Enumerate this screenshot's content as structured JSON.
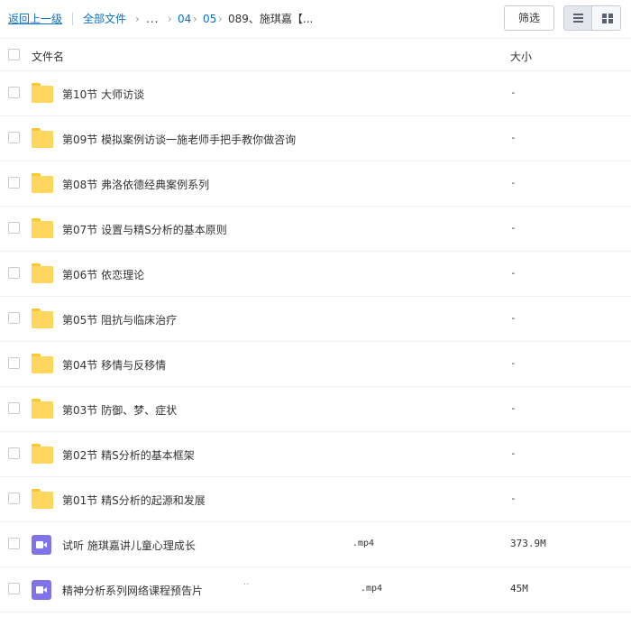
{
  "breadcrumb": {
    "back": "返回上一级",
    "all_files": "全部文件",
    "arrow": "›",
    "dots": "...",
    "level_04": "04",
    "level_05": "05",
    "current": "089、施琪嘉【..."
  },
  "toolbar": {
    "filter_label": "筛选",
    "active_view": "list"
  },
  "table": {
    "col_name": "文件名",
    "col_size": "大小",
    "rows": [
      {
        "type": "folder",
        "name": "第10节 大师访谈",
        "size": "-"
      },
      {
        "type": "folder",
        "name": "第09节 模拟案例访谈一施老师手把手教你做咨询",
        "size": "-"
      },
      {
        "type": "folder",
        "name": "第08节 弗洛依德经典案例系列",
        "size": "-"
      },
      {
        "type": "folder",
        "name": "第07节 设置与精S分析的基本原则",
        "size": "-"
      },
      {
        "type": "folder",
        "name": "第06节 依恋理论",
        "size": "-"
      },
      {
        "type": "folder",
        "name": "第05节 阻抗与临床治疗",
        "size": "-"
      },
      {
        "type": "folder",
        "name": "第04节 移情与反移情",
        "size": "-"
      },
      {
        "type": "folder",
        "name": "第03节 防御、梦、症状",
        "size": "-"
      },
      {
        "type": "folder",
        "name": "第02节 精S分析的基本框架",
        "size": "-"
      },
      {
        "type": "folder",
        "name": "第01节 精S分析的起源和发展",
        "size": "-"
      },
      {
        "type": "video",
        "name": "试听 施琪嘉讲儿童心理成长",
        "ext": ".mp4",
        "size": "373.9M"
      },
      {
        "type": "video",
        "name": "精神分析系列网络课程预告片",
        "dot": "··",
        "ext": ".mp4",
        "size": "45M"
      }
    ]
  },
  "colors": {
    "link": "#0a6fc9",
    "folder": "#ffd75e",
    "video": "#7f73e8"
  }
}
